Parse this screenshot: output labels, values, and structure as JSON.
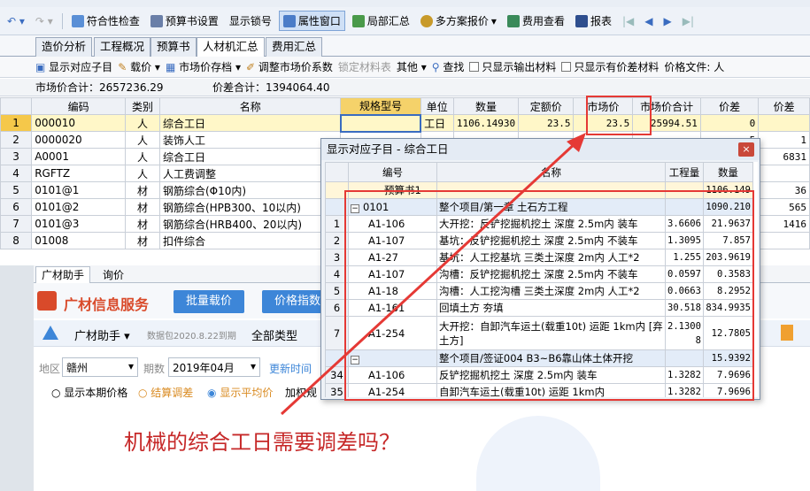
{
  "toolbar": {
    "items": [
      {
        "label": "符合性检查",
        "color": "#5a8fd6"
      },
      {
        "label": "预算书设置",
        "color": "#6a7fa8"
      },
      {
        "label": "显示锁号",
        "color": ""
      },
      {
        "label": "属性窗口",
        "color": "#4a7cc8"
      },
      {
        "label": "局部汇总",
        "color": "#4a9a4a"
      },
      {
        "label": "多方案报价",
        "color": "#c89a2a"
      },
      {
        "label": "费用查看",
        "color": "#3a8a5a"
      },
      {
        "label": "报表",
        "color": "#2e4e8e"
      }
    ]
  },
  "tabs": [
    "造价分析",
    "工程概况",
    "预算书",
    "人材机汇总",
    "费用汇总"
  ],
  "subbar": {
    "show_child": "显示对应子目",
    "load_price": "载价",
    "market_archive": "市场价存档",
    "adjust_factor": "调整市场价系数",
    "lock_table": "锁定材料表",
    "other": "其他",
    "find": "查找",
    "only_output": "只显示输出材料",
    "only_diff": "只显示有价差材料",
    "price_file": "价格文件: 人"
  },
  "totals": {
    "market_total_label": "市场价合计：",
    "market_total": "2657236.29",
    "diff_total_label": "价差合计：",
    "diff_total": "1394064.40"
  },
  "grid": {
    "headers": [
      "编码",
      "类别",
      "名称",
      "规格型号",
      "单位",
      "数量",
      "定额价",
      "市场价",
      "市场价合计",
      "价差",
      "价差"
    ],
    "rows": [
      {
        "no": "1",
        "code": "000010",
        "cat": "人",
        "name": "综合工日",
        "spec": "",
        "unit": "工日",
        "qty": "1106.14930",
        "base": "23.5",
        "market": "23.5",
        "mtotal": "25994.51",
        "diff": "0",
        "diff2": ""
      },
      {
        "no": "2",
        "code": "0000020",
        "cat": "人",
        "name": "装饰人工",
        "spec": "",
        "unit": "",
        "qty": "",
        "base": "",
        "market": "",
        "mtotal": "",
        "diff": "5",
        "diff2": "1"
      },
      {
        "no": "3",
        "code": "A0001",
        "cat": "人",
        "name": "综合工日",
        "spec": "",
        "unit": "",
        "qty": "",
        "base": "",
        "market": "",
        "mtotal": "",
        "diff": "45",
        "diff2": "6831"
      },
      {
        "no": "4",
        "code": "RGFTZ",
        "cat": "人",
        "name": "人工费调整",
        "spec": "",
        "unit": "",
        "qty": "",
        "base": "",
        "market": "",
        "mtotal": "",
        "diff": "0",
        "diff2": ""
      },
      {
        "no": "5",
        "code": "0101@1",
        "cat": "材",
        "name": "钢筋综合(Φ10内)",
        "spec": "",
        "unit": "",
        "qty": "",
        "base": "",
        "market": "",
        "mtotal": "",
        "diff": "02",
        "diff2": "36"
      },
      {
        "no": "6",
        "code": "0101@2",
        "cat": "材",
        "name": "钢筋综合(HPB300、10以内)",
        "spec": "",
        "unit": "",
        "qty": "",
        "base": "",
        "market": "",
        "mtotal": "",
        "diff": "02",
        "diff2": "565"
      },
      {
        "no": "7",
        "code": "0101@3",
        "cat": "材",
        "name": "钢筋综合(HRB400、20以内)",
        "spec": "",
        "unit": "",
        "qty": "",
        "base": "",
        "market": "",
        "mtotal": "",
        "diff": "02",
        "diff2": "1416"
      },
      {
        "no": "8",
        "code": "01008",
        "cat": "材",
        "name": "扣件综合",
        "spec": "",
        "unit": "",
        "qty": "",
        "base": "",
        "market": "",
        "mtotal": "",
        "diff": "",
        "diff2": ""
      }
    ]
  },
  "lower": {
    "tab1": "广材助手",
    "tab2": "询价",
    "service_title": "广材信息服务",
    "batch_btn": "批量载价",
    "index_btn": "价格指数",
    "assistant": "广材助手",
    "data_expire": "数据包2020.8.22到期",
    "all_types": "全部类型",
    "region_label": "地区",
    "region_value": "赣州",
    "period_label": "期数",
    "period_value": "2019年04月",
    "refresh": "更新时间",
    "opt1": "显示本期价格",
    "opt2": "结算调差",
    "opt3": "显示平均价",
    "opt4": "加权规"
  },
  "dialog": {
    "title": "显示对应子目 - 综合工日",
    "close": "×",
    "headers": [
      "编号",
      "名称",
      "工程量",
      "数量"
    ],
    "rows": [
      {
        "type": "first",
        "no": "",
        "code": "预算书1",
        "name": "",
        "qty": "",
        "amount": "1106.149"
      },
      {
        "type": "grp",
        "no": "",
        "code": "0101",
        "name": "整个项目/第一章 土石方工程",
        "qty": "",
        "amount": "1090.210"
      },
      {
        "type": "item",
        "no": "1",
        "code": "A1-106",
        "name": "大开挖：反铲挖掘机挖土 深度 2.5m内 装车",
        "qty": "3.6606",
        "amount": "21.9637"
      },
      {
        "type": "item",
        "no": "2",
        "code": "A1-107",
        "name": "基坑：反铲挖掘机挖土 深度 2.5m内 不装车",
        "qty": "1.3095",
        "amount": "7.857"
      },
      {
        "type": "item",
        "no": "3",
        "code": "A1-27",
        "name": "基坑：人工挖基坑 三类土深度 2m内 人工*2",
        "qty": "1.255",
        "amount": "203.9619"
      },
      {
        "type": "item",
        "no": "4",
        "code": "A1-107",
        "name": "沟槽：反铲挖掘机挖土 深度 2.5m内 不装车",
        "qty": "0.0597",
        "amount": "0.3583"
      },
      {
        "type": "item",
        "no": "5",
        "code": "A1-18",
        "name": "沟槽：人工挖沟槽 三类土深度 2m内 人工*2",
        "qty": "0.0663",
        "amount": "8.2952"
      },
      {
        "type": "item",
        "no": "6",
        "code": "A1-161",
        "name": "回填土方 夯填",
        "qty": "30.518",
        "amount": "834.9935"
      },
      {
        "type": "item2",
        "no": "7",
        "code": "A1-254",
        "name": "大开挖：自卸汽车运土(载重10t) 运距 1km内 [弃土方]",
        "qty": "2.13008",
        "amount": "12.7805"
      },
      {
        "type": "grp",
        "no": "",
        "code": "",
        "name": "整个项目/签证004 B3~B6靠山体土体开挖",
        "qty": "",
        "amount": "15.9392"
      },
      {
        "type": "item",
        "no": "34",
        "code": "A1-106",
        "name": "反铲挖掘机挖土 深度 2.5m内 装车",
        "qty": "1.3282",
        "amount": "7.9696"
      },
      {
        "type": "item",
        "no": "35",
        "code": "A1-254",
        "name": "自卸汽车运土(载重10t) 运距 1km内",
        "qty": "1.3282",
        "amount": "7.9696"
      }
    ]
  },
  "annotation": {
    "question": "机械的综合工日需要调差吗？",
    "color": "#e53935"
  }
}
